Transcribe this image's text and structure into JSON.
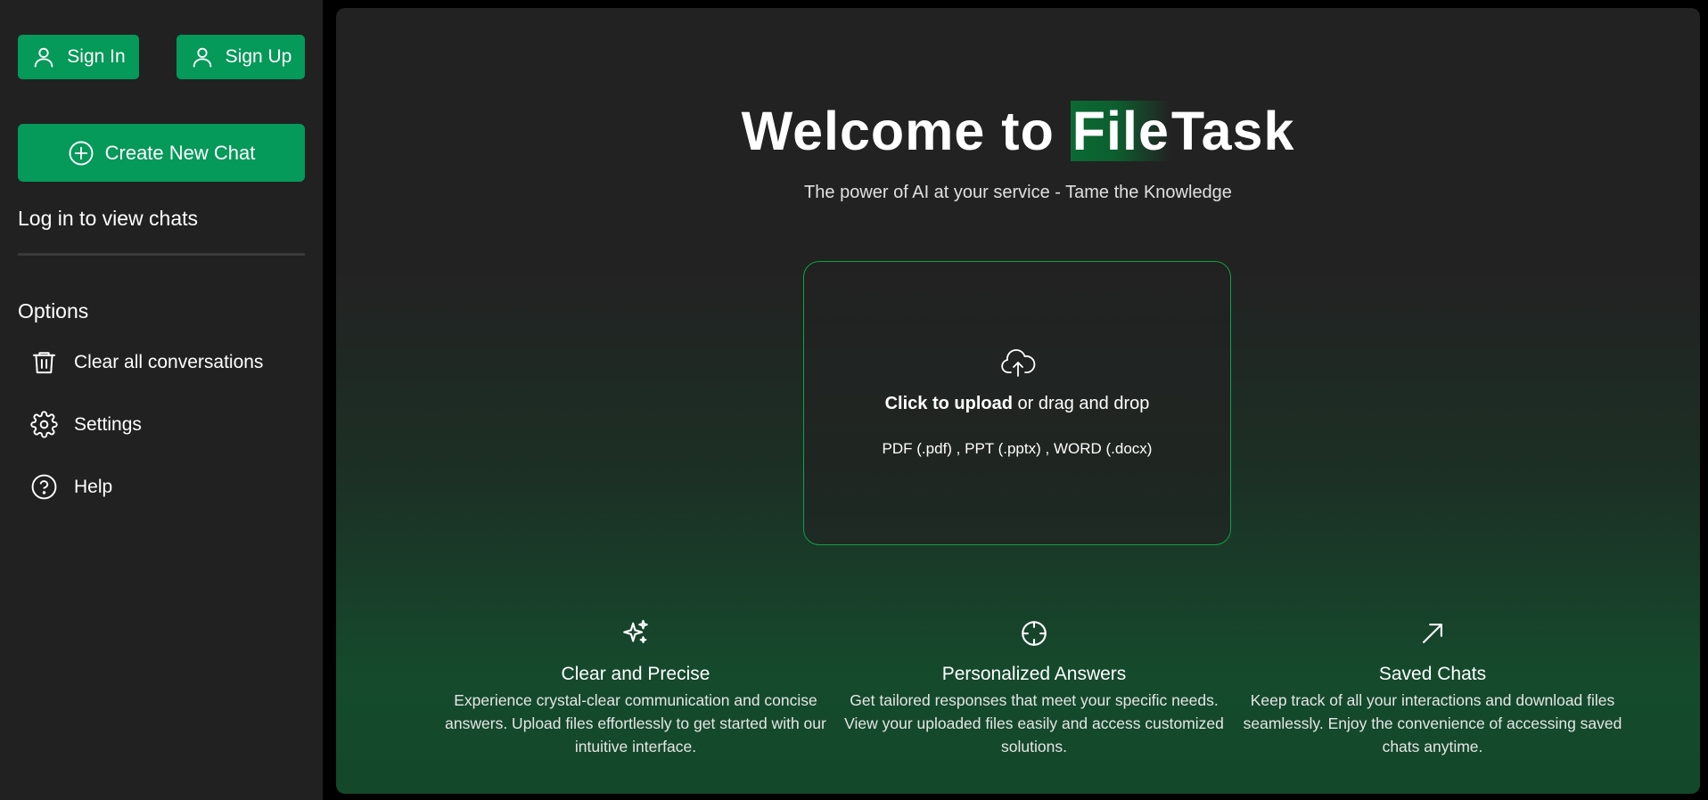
{
  "sidebar": {
    "sign_in_label": "Sign In",
    "sign_up_label": "Sign Up",
    "new_chat_label": "Create New Chat",
    "login_prompt": "Log in to view chats",
    "options_title": "Options",
    "options": [
      {
        "label": "Clear all conversations",
        "icon": "trash-icon"
      },
      {
        "label": "Settings",
        "icon": "gear-icon"
      },
      {
        "label": "Help",
        "icon": "help-circle-icon"
      }
    ]
  },
  "main": {
    "title_prefix": "Welcome to ",
    "title_highlight": "File",
    "title_suffix": "Task",
    "subtitle": "The power of AI at your service - Tame the Knowledge",
    "upload": {
      "icon": "cloud-upload-icon",
      "click_text": "Click to upload",
      "drag_text": " or drag and drop",
      "formats": "PDF (.pdf) , PPT (.pptx) , WORD (.docx)"
    },
    "features": [
      {
        "icon": "sparkles-icon",
        "title": "Clear and Precise",
        "desc": "Experience crystal-clear communication and concise answers. Upload files effortlessly to get started with our intuitive interface."
      },
      {
        "icon": "crosshair-icon",
        "title": "Personalized Answers",
        "desc": "Get tailored responses that meet your specific needs. View your uploaded files easily and access customized solutions."
      },
      {
        "icon": "arrow-up-right-icon",
        "title": "Saved Chats",
        "desc": "Keep track of all your interactions and download files seamlessly. Enjoy the convenience of accessing saved chats anytime."
      }
    ]
  },
  "colors": {
    "accent": "#05995a",
    "upload_border": "#10a146",
    "sidebar_bg": "#212121"
  }
}
